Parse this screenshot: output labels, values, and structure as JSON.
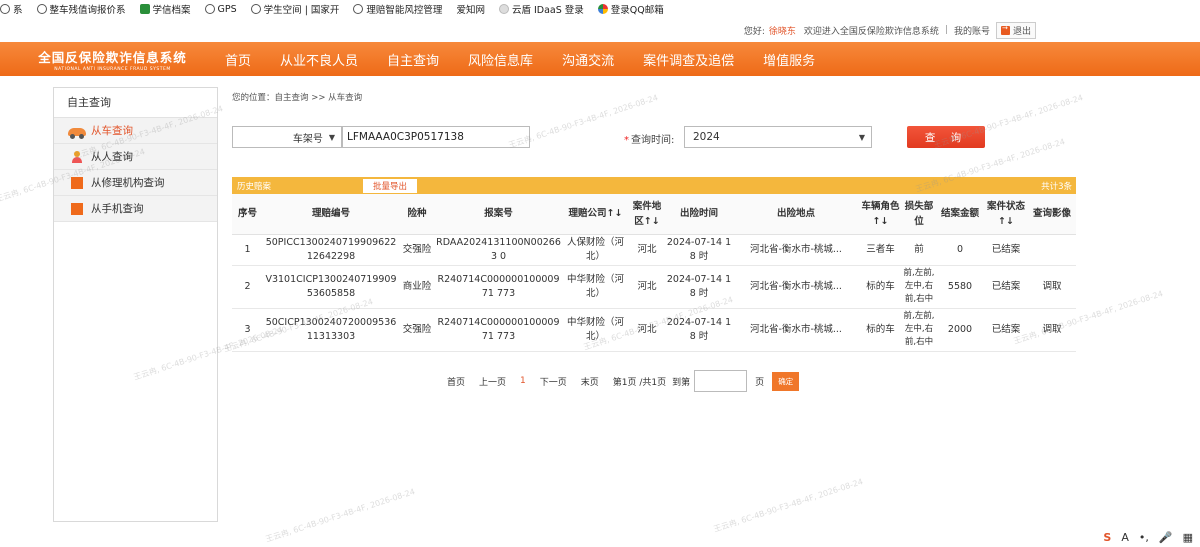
{
  "bookmarks": [
    {
      "label": "系",
      "icon": "globe-icon"
    },
    {
      "label": "整车残值询报价系",
      "icon": "globe-icon"
    },
    {
      "label": "学信档案",
      "icon": "leaf-icon"
    },
    {
      "label": "GPS",
      "icon": "globe-icon"
    },
    {
      "label": "学生空间 | 国家开",
      "icon": "globe-icon"
    },
    {
      "label": "理赔智能风控管理",
      "icon": "globe-icon"
    },
    {
      "label": "爱知网",
      "icon": "page-icon"
    },
    {
      "label": "云盾 IDaaS 登录",
      "icon": "page-icon"
    },
    {
      "label": "登录QQ邮箱",
      "icon": "mail-icon"
    }
  ],
  "userbar": {
    "greeting": "您好:",
    "username": "徐晓东",
    "welcome": "欢迎进入全国反保险欺诈信息系统",
    "sep": "|",
    "account": "我的账号",
    "logout": "退出"
  },
  "logo": {
    "cn": "全国反保险欺诈信息系统",
    "en": "NATIONAL ANTI INSURANCE FRAUD SYSTEM"
  },
  "nav": [
    "首页",
    "从业不良人员",
    "自主查询",
    "风险信息库",
    "沟通交流",
    "案件调查及追偿",
    "增值服务"
  ],
  "sidebar": {
    "title": "自主查询",
    "items": [
      {
        "label": "从车查询",
        "icon": "car-icon",
        "active": true
      },
      {
        "label": "从人查询",
        "icon": "person-icon",
        "active": false
      },
      {
        "label": "从修理机构查询",
        "icon": "org-icon",
        "active": false
      },
      {
        "label": "从手机查询",
        "icon": "org-icon",
        "active": false
      }
    ]
  },
  "breadcrumb": "您的位置：自主查询 >> 从车查询",
  "search": {
    "type_value": "车架号",
    "vin_value": "LFMAAA0C3P0517138",
    "time_label": "查询时间:",
    "required_mark": "*",
    "year_value": "2024",
    "query_button": "查 询"
  },
  "grid": {
    "title": "历史赔案",
    "export_button": "批量导出",
    "count": "共计3条",
    "headers": [
      "序号",
      "理赔编号",
      "险种",
      "报案号",
      "理赔公司↑↓",
      "案件地区↑↓",
      "出险时间",
      "出险地点",
      "车辆角色↑↓",
      "损失部位",
      "结案金额",
      "案件状态↑↓",
      "查询影像"
    ],
    "rows": [
      [
        "1",
        "50PICC1300240719909622 12642298",
        "交强险",
        "RDAA2024131100N002663 0",
        "人保财险（河北）",
        "河北",
        "2024-07-14 18 时",
        "河北省-衡水市-桃城...",
        "三者车",
        "前",
        "0",
        "已结案",
        ""
      ],
      [
        "2",
        "V3101CICP1300240719909 53605858",
        "商业险",
        "R240714C00000010000971 773",
        "中华财险（河北）",
        "河北",
        "2024-07-14 18 时",
        "河北省-衡水市-桃城...",
        "标的车",
        "前,左前,左中,右前,右中",
        "5580",
        "已结案",
        "调取"
      ],
      [
        "3",
        "50CICP1300240720009536 11313303",
        "交强险",
        "R240714C00000010000971 773",
        "中华财险（河北）",
        "河北",
        "2024-07-14 18 时",
        "河北省-衡水市-桃城...",
        "标的车",
        "前,左前,左中,右前,右中",
        "2000",
        "已结案",
        "调取"
      ]
    ]
  },
  "pager": {
    "first": "首页",
    "prev": "上一页",
    "current": "1",
    "next": "下一页",
    "last": "末页",
    "info": "第1页 /共1页",
    "goto": "到第",
    "page_unit": "页",
    "confirm": "确定"
  },
  "watermark": "王云冉, 6C-4B-90-F3-4B-4F, 2026-08-24",
  "tray": [
    "S",
    "A",
    "•,",
    "🎤",
    "▦"
  ],
  "colors": {
    "nav_orange": "#ee6a17",
    "grid_bar": "#f4b73d",
    "query_red": "#e23a20",
    "accent": "#e2552b"
  }
}
